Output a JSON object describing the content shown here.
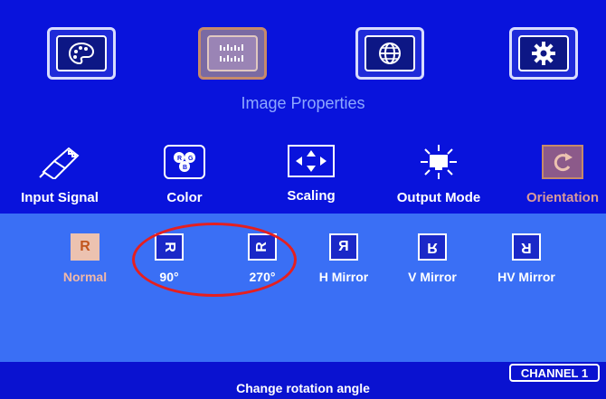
{
  "top_menu": {
    "items": [
      {
        "icon": "palette-icon"
      },
      {
        "icon": "image-properties-icon",
        "active": true
      },
      {
        "icon": "globe-icon"
      },
      {
        "icon": "gear-icon"
      }
    ],
    "title": "Image Properties"
  },
  "categories": [
    {
      "label": "Input Signal",
      "icon": "usb-cable-icon"
    },
    {
      "label": "Color",
      "icon": "color-dots-icon"
    },
    {
      "label": "Scaling",
      "icon": "scaling-arrows-icon"
    },
    {
      "label": "Output Mode",
      "icon": "monitor-sun-icon"
    },
    {
      "label": "Orientation",
      "icon": "rotate-icon",
      "active": true
    }
  ],
  "options": [
    {
      "label": "Normal",
      "glyph": "R",
      "active": true
    },
    {
      "label": "90°",
      "glyph": "R"
    },
    {
      "label": "270°",
      "glyph": "R"
    },
    {
      "label": "H Mirror",
      "glyph": "R"
    },
    {
      "label": "V Mirror",
      "glyph": "R"
    },
    {
      "label": "HV Mirror",
      "glyph": "R"
    }
  ],
  "status_text": "Change rotation angle",
  "channel_badge": "CHANNEL 1",
  "colors": {
    "background": "#0913dc",
    "options_panel": "#3a6ff5",
    "highlight_ring": "#e51f1f",
    "active_option": "#ecc2b0"
  }
}
